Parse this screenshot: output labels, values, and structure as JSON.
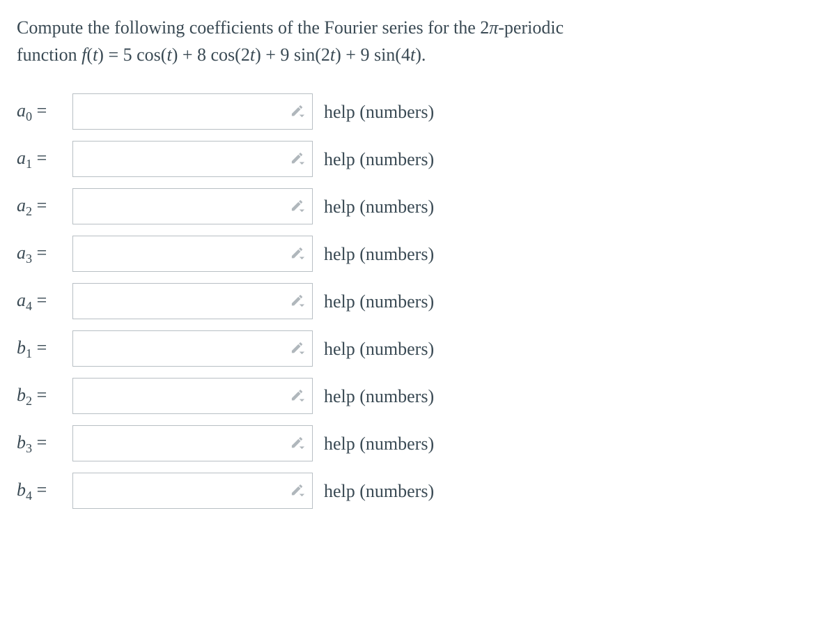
{
  "prompt": {
    "line1_pre": "Compute the following coefficients of the Fourier series for the ",
    "period": "2π",
    "line1_post": "-periodic",
    "line2_pre": "function ",
    "func_lhs": "f(t) = ",
    "func_rhs": "5 cos(t) + 8 cos(2t) + 9 sin(2t) + 9 sin(4t).",
    "func_rhs_html": "5 cos(<span class='math-it'>t</span>) + 8 cos(2<span class='math-it'>t</span>) + 9 sin(2<span class='math-it'>t</span>) + 9 sin(4<span class='math-it'>t</span>)."
  },
  "help_text": "help (numbers)",
  "rows": [
    {
      "var": "a",
      "sub": "0",
      "value": ""
    },
    {
      "var": "a",
      "sub": "1",
      "value": ""
    },
    {
      "var": "a",
      "sub": "2",
      "value": ""
    },
    {
      "var": "a",
      "sub": "3",
      "value": ""
    },
    {
      "var": "a",
      "sub": "4",
      "value": ""
    },
    {
      "var": "b",
      "sub": "1",
      "value": ""
    },
    {
      "var": "b",
      "sub": "2",
      "value": ""
    },
    {
      "var": "b",
      "sub": "3",
      "value": ""
    },
    {
      "var": "b",
      "sub": "4",
      "value": ""
    }
  ]
}
